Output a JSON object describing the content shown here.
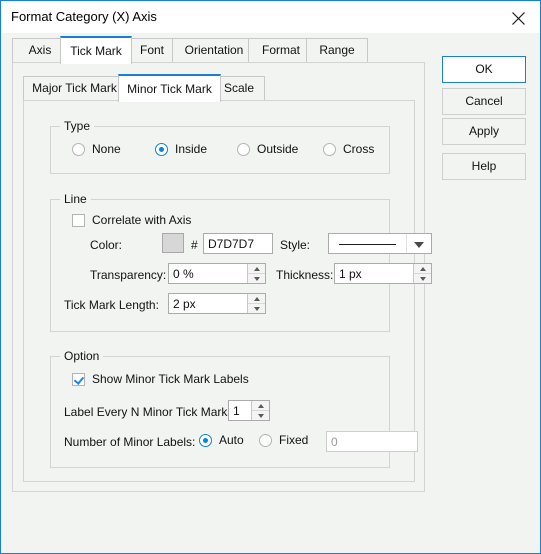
{
  "window": {
    "title": "Format Category (X) Axis",
    "close_icon": "close-icon"
  },
  "tabs": [
    {
      "label": "Axis",
      "active": false
    },
    {
      "label": "Tick Mark",
      "active": true
    },
    {
      "label": "Font",
      "active": false
    },
    {
      "label": "Orientation",
      "active": false
    },
    {
      "label": "Format",
      "active": false
    },
    {
      "label": "Range",
      "active": false
    }
  ],
  "subtabs": [
    {
      "label": "Major Tick Mark",
      "active": false
    },
    {
      "label": "Minor Tick Mark",
      "active": true
    },
    {
      "label": "Scale",
      "active": false
    }
  ],
  "type_group": {
    "title": "Type",
    "options": [
      {
        "label": "None",
        "selected": false
      },
      {
        "label": "Inside",
        "selected": true
      },
      {
        "label": "Outside",
        "selected": false
      },
      {
        "label": "Cross",
        "selected": false
      }
    ]
  },
  "line_group": {
    "title": "Line",
    "correlate_label": "Correlate with Axis",
    "correlate_checked": false,
    "color_label": "Color:",
    "hash_symbol": "#",
    "color_value": "D7D7D7",
    "color_swatch_hex": "#D7D7D7",
    "style_label": "Style:",
    "style_value": "solid-line",
    "transparency_label": "Transparency:",
    "transparency_value": "0 %",
    "thickness_label": "Thickness:",
    "thickness_value": "1 px",
    "tick_length_label": "Tick Mark Length:",
    "tick_length_value": "2 px"
  },
  "option_group": {
    "title": "Option",
    "show_labels_label": "Show Minor Tick Mark Labels",
    "show_labels_checked": true,
    "label_every_label": "Label Every N Minor Tick Marks:",
    "label_every_value": "1",
    "number_labels_label": "Number of Minor Labels:",
    "auto_label": "Auto",
    "auto_selected": true,
    "fixed_label": "Fixed",
    "fixed_selected": false,
    "fixed_value": "0"
  },
  "buttons": {
    "ok": "OK",
    "cancel": "Cancel",
    "apply": "Apply",
    "help": "Help"
  },
  "colors": {
    "accent": "#1a7fd4",
    "dialog_bg": "#f2f4f2",
    "panel_border": "#d3d3d3"
  }
}
